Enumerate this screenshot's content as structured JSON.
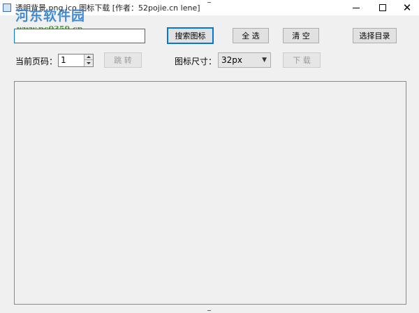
{
  "window": {
    "title": "透明背景 png ico 图标下载 [作者：52pojie.cn lene]",
    "close_symbol": "✕",
    "controls": [
      "minimize-icon",
      "maximize-icon",
      "close-icon"
    ]
  },
  "watermark": {
    "logo_text": "河东软件园",
    "url": "www.pc0359.cn"
  },
  "search": {
    "value": "",
    "placeholder": ""
  },
  "toolbar": {
    "search_icons_label": "搜索图标",
    "select_all_label": "全 选",
    "clear_label": "清 空",
    "choose_dir_label": "选择目录",
    "jump_label": "跳 转",
    "download_label": "下 载"
  },
  "paging": {
    "label": "当前页码：",
    "value": "1"
  },
  "icon_size": {
    "label": "图标尺寸：",
    "selected": "32px",
    "chevron": "▼"
  },
  "colors": {
    "accent": "#0078d7",
    "window_bg": "#f0f0f0"
  }
}
